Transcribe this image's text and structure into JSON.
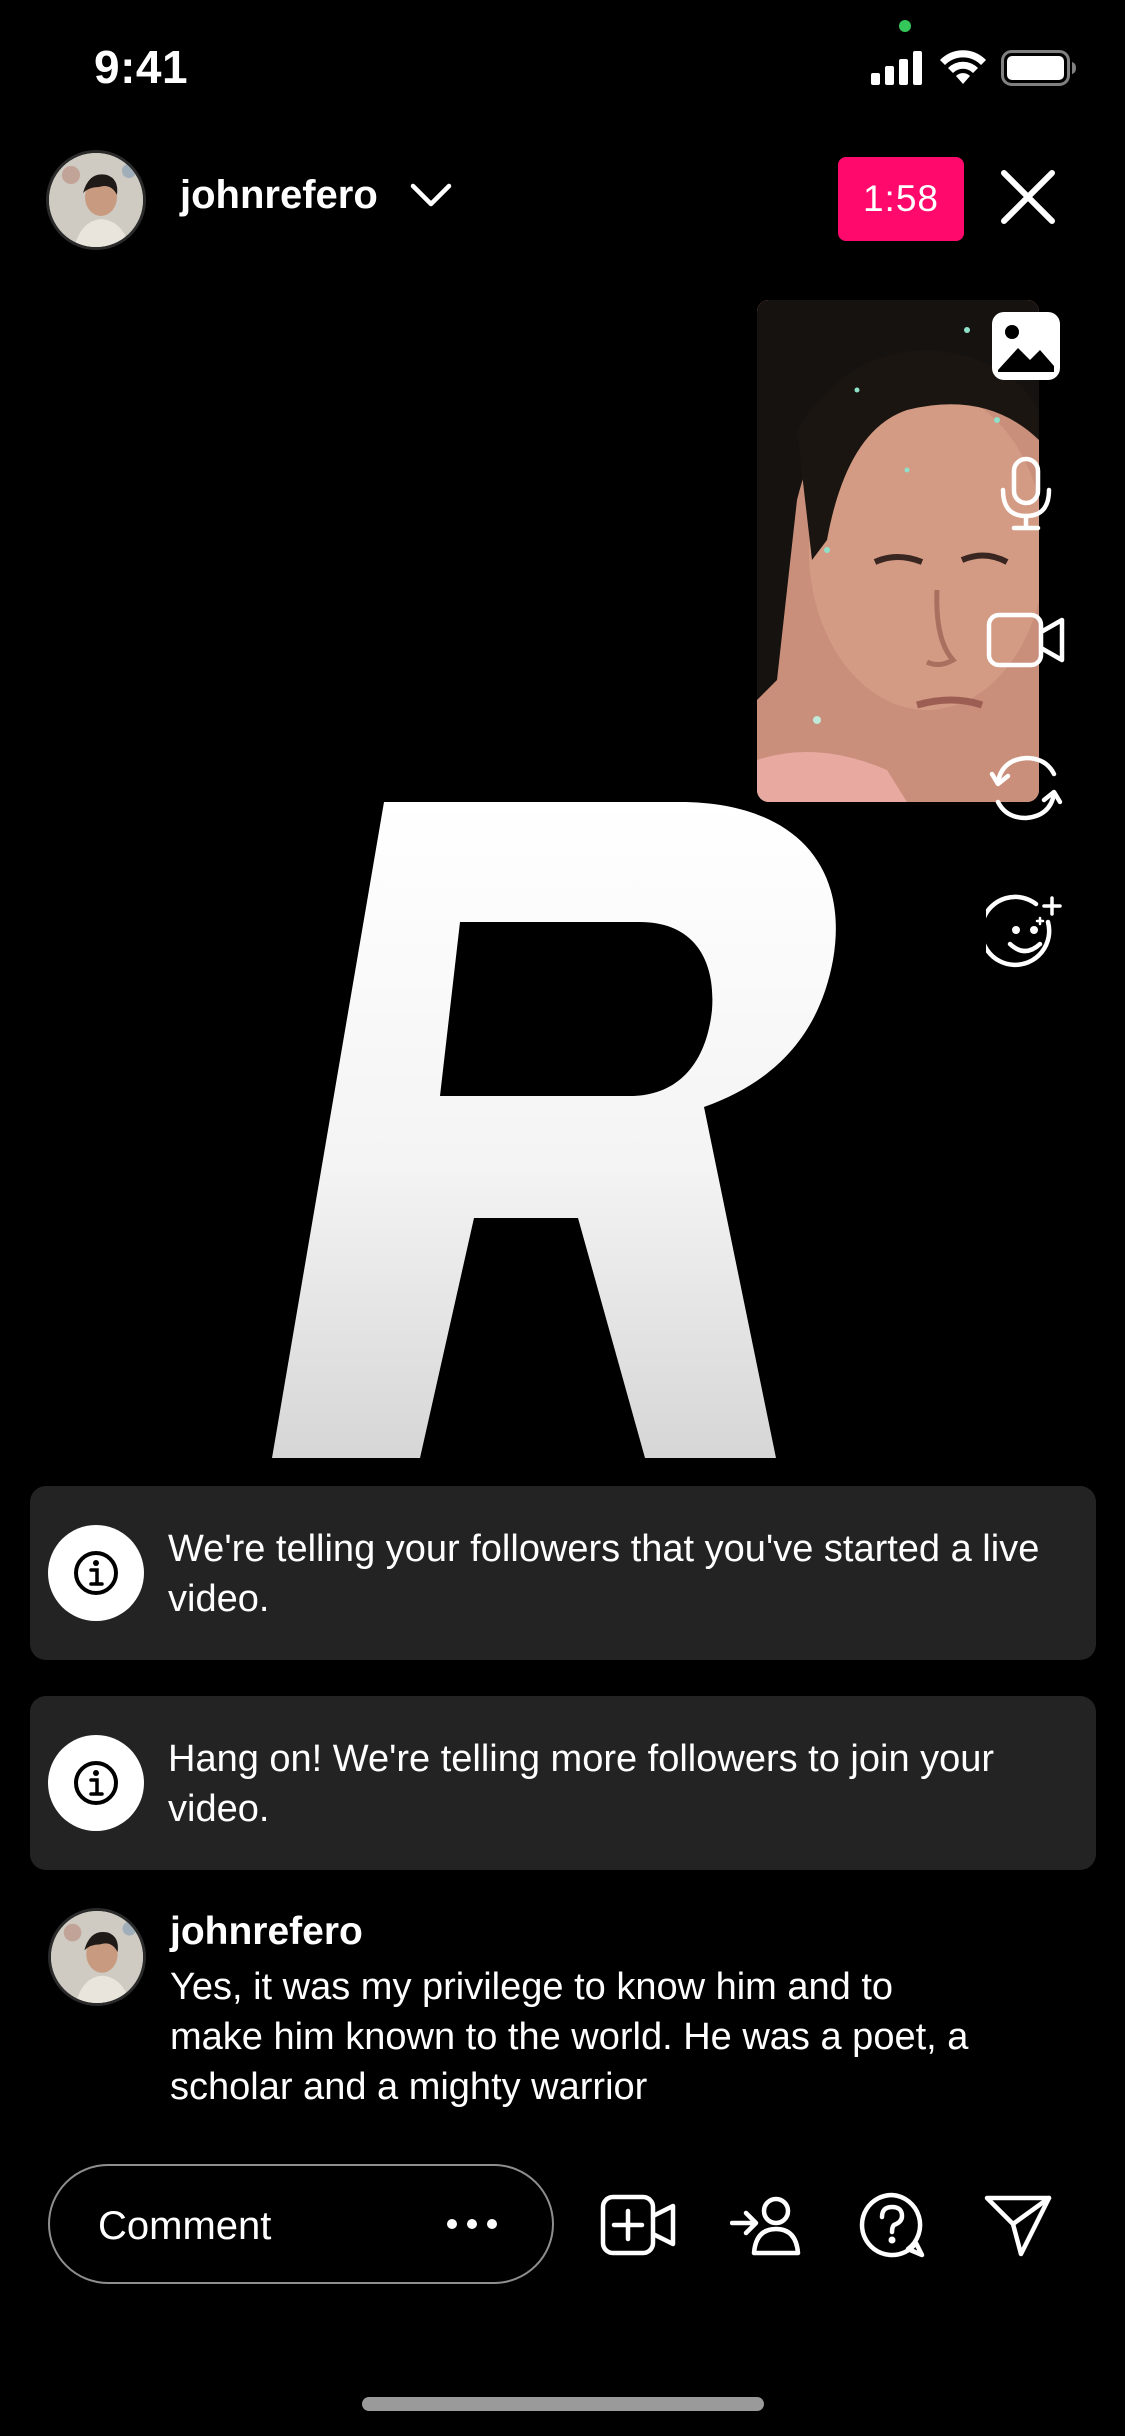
{
  "status_bar": {
    "time": "9:41"
  },
  "header": {
    "username": "johnrefero",
    "timer": "1:58"
  },
  "stage": {
    "graphic_letter": "R"
  },
  "tools": [
    "image-icon",
    "microphone-icon",
    "video-camera-icon",
    "flip-camera-icon",
    "effects-icon"
  ],
  "notices": [
    {
      "text": "We're telling your followers that you've started a live video."
    },
    {
      "text": "Hang on! We're telling more followers to join your video."
    }
  ],
  "comment": {
    "username": "johnrefero",
    "text": "Yes, it was my privilege to know him and to make him known to the world. He was a poet, a scholar and a mighty warrior"
  },
  "bottom_bar": {
    "comment_placeholder": "Comment",
    "icons": [
      "add-video-guest-icon",
      "invite-icon",
      "question-icon",
      "share-icon"
    ]
  },
  "colors": {
    "live_badge": "#ff0a6c",
    "notice_bg": "#232323",
    "background": "#000000"
  }
}
